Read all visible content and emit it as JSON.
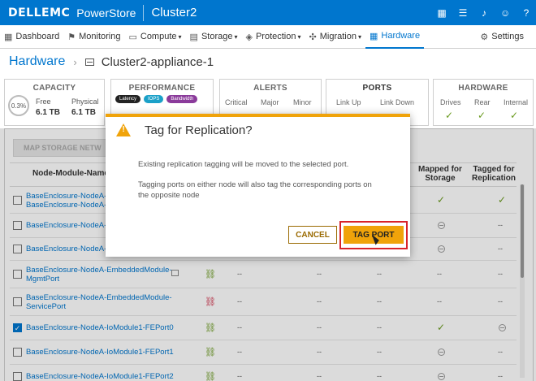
{
  "topbar": {
    "brand": "DELLEMC",
    "product": "PowerStore",
    "cluster": "Cluster2"
  },
  "nav": {
    "items": [
      {
        "label": "Dashboard",
        "icon": "dashboard-icon",
        "glyph": "▦"
      },
      {
        "label": "Monitoring",
        "icon": "flag-icon",
        "glyph": "⚑"
      },
      {
        "label": "Compute",
        "icon": "compute-icon",
        "glyph": "▭",
        "dropdown": true
      },
      {
        "label": "Storage",
        "icon": "storage-icon",
        "glyph": "▤",
        "dropdown": true
      },
      {
        "label": "Protection",
        "icon": "shield-icon",
        "glyph": "◈",
        "dropdown": true
      },
      {
        "label": "Migration",
        "icon": "migration-icon",
        "glyph": "✣",
        "dropdown": true
      },
      {
        "label": "Hardware",
        "icon": "hardware-icon",
        "glyph": "▦",
        "active": true
      }
    ],
    "settings": "Settings"
  },
  "breadcrumb": {
    "root": "Hardware",
    "current": "Cluster2-appliance-1"
  },
  "cards": {
    "capacity": {
      "title": "CAPACITY",
      "percent": "0.3%",
      "free_label": "Free",
      "free_value": "6.1 TB",
      "physical_label": "Physical",
      "physical_value": "6.1 TB"
    },
    "performance": {
      "title": "PERFORMANCE",
      "pills": [
        "Latency",
        "IOPS",
        "Bandwidth"
      ]
    },
    "alerts": {
      "title": "ALERTS",
      "levels": [
        "Critical",
        "Major",
        "Minor"
      ]
    },
    "ports": {
      "title": "PORTS",
      "cols": [
        "Link Up",
        "Link Down"
      ]
    },
    "hardware": {
      "title": "HARDWARE",
      "cols": [
        "Drives",
        "Rear",
        "Internal"
      ]
    }
  },
  "toolbar": {
    "map_storage": "MAP STORAGE NETW"
  },
  "table": {
    "headers": {
      "name": "Node-Module-Name",
      "mapped": "Mapped for Storage",
      "tagged": "Tagged for Replication"
    },
    "rows": [
      {
        "name": "BaseEnclosure-NodeA-",
        "name2": "BaseEnclosure-NodeA-",
        "checked": false,
        "mapped": "check",
        "tagged": "check"
      },
      {
        "name": "BaseEnclosure-NodeA-",
        "checked": false,
        "mapped": "circle",
        "tagged": "--"
      },
      {
        "name": "BaseEnclosure-NodeA-",
        "checked": false,
        "mapped": "circle",
        "tagged": "--"
      },
      {
        "name": "BaseEnclosure-NodeA-EmbeddedModule-",
        "name2": "MgmtPort",
        "checked": false,
        "link": "ok",
        "c1": "--",
        "c2": "--",
        "c3": "--",
        "mapped": "--",
        "tagged": "--"
      },
      {
        "name": "BaseEnclosure-NodeA-EmbeddedModule-",
        "name2": "ServicePort",
        "checked": false,
        "link": "broken",
        "c1": "--",
        "c2": "--",
        "c3": "--",
        "mapped": "--",
        "tagged": "--"
      },
      {
        "name": "BaseEnclosure-NodeA-IoModule1-FEPort0",
        "checked": true,
        "link": "ok",
        "c1": "--",
        "c2": "--",
        "c3": "--",
        "mapped": "check",
        "tagged": "circle"
      },
      {
        "name": "BaseEnclosure-NodeA-IoModule1-FEPort1",
        "checked": false,
        "link": "ok",
        "c1": "--",
        "c2": "--",
        "c3": "--",
        "mapped": "circle",
        "tagged": "--"
      },
      {
        "name": "BaseEnclosure-NodeA-IoModule1-FEPort2",
        "checked": false,
        "link": "ok",
        "c1": "--",
        "c2": "--",
        "c3": "--",
        "mapped": "circle",
        "tagged": "--"
      }
    ]
  },
  "modal": {
    "title": "Tag for Replication?",
    "line1": "Existing replication tagging will be moved to the selected port.",
    "line2": "Tagging ports on either node will also tag the corresponding ports on",
    "line3": "the opposite node",
    "cancel": "CANCEL",
    "confirm": "TAG PORT"
  },
  "colors": {
    "accent": "#0076ce",
    "warning": "#f0a30a",
    "success": "#6a9a1f",
    "danger": "#d0304a"
  }
}
